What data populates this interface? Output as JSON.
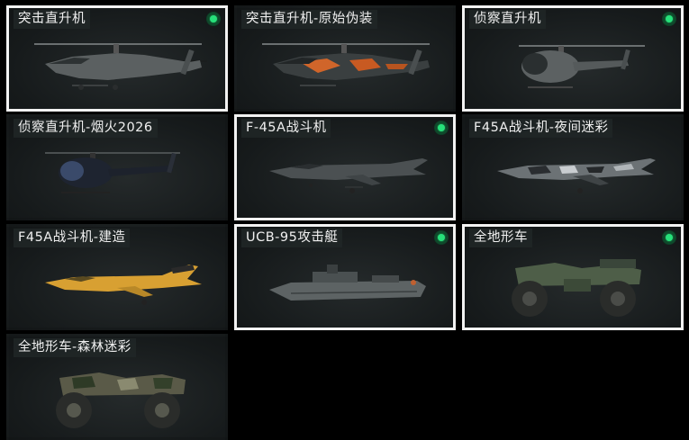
{
  "vehicles": [
    {
      "name": "突击直升机",
      "equipped": true
    },
    {
      "name": "突击直升机-原始伪装",
      "equipped": false
    },
    {
      "name": "侦察直升机",
      "equipped": true
    },
    {
      "name": "侦察直升机-烟火2026",
      "equipped": false
    },
    {
      "name": "F-45A战斗机",
      "equipped": true
    },
    {
      "name": "F45A战斗机-夜间迷彩",
      "equipped": false
    },
    {
      "name": "F45A战斗机-建造",
      "equipped": false
    },
    {
      "name": "UCB-95攻击艇",
      "equipped": true
    },
    {
      "name": "全地形车",
      "equipped": true
    },
    {
      "name": "全地形车-森林迷彩",
      "equipped": false
    }
  ],
  "icons": {
    "equipped_indicator": "green-dot-icon",
    "vehicle_art": [
      "attack-helicopter-icon",
      "attack-helicopter-camo-icon",
      "scout-helicopter-icon",
      "scout-helicopter-fireworks-icon",
      "fighter-jet-icon",
      "fighter-jet-night-camo-icon",
      "fighter-jet-build-icon",
      "attack-boat-icon",
      "atv-icon",
      "atv-forest-camo-icon"
    ]
  },
  "colors": {
    "equipped_dot": "#27e07a",
    "selected_border": "#f2f2f2",
    "background": "#000000"
  }
}
